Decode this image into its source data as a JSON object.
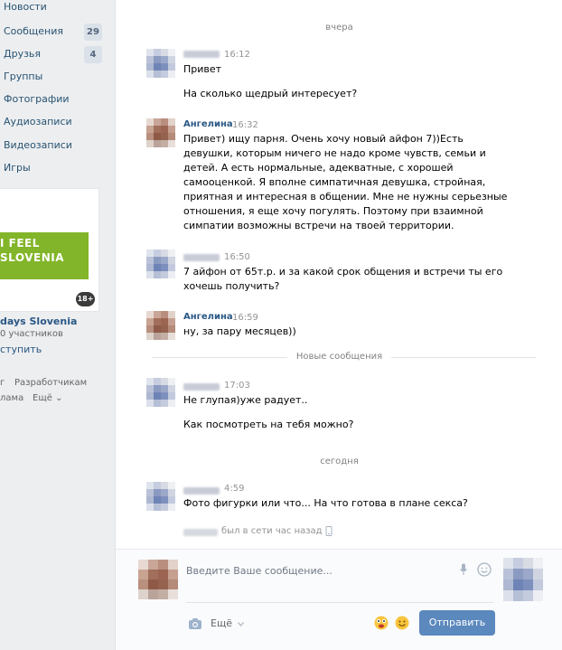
{
  "sidebar": {
    "items": [
      {
        "label": "Новости",
        "badge": ""
      },
      {
        "label": "Сообщения",
        "badge": "29"
      },
      {
        "label": "Друзья",
        "badge": "4"
      },
      {
        "label": "Группы",
        "badge": ""
      },
      {
        "label": "Фотографии",
        "badge": ""
      },
      {
        "label": "Аудиозаписи",
        "badge": ""
      },
      {
        "label": "Видеозаписи",
        "badge": ""
      },
      {
        "label": "Игры",
        "badge": ""
      }
    ],
    "ad": {
      "banner_line1": "I FEEL",
      "banner_line2": "SLOVENIA",
      "age_badge": "18+",
      "title": "days Slovenia",
      "members": "0 участников",
      "join": "ступить"
    },
    "footer": {
      "link1": "г",
      "link2": "Разработчикам",
      "link3": "лама",
      "more": "Ещё ⌄"
    }
  },
  "chat": {
    "separators": {
      "yesterday": "вчера",
      "new_messages": "Новые сообщения",
      "today": "сегодня"
    },
    "messages": [
      {
        "author": "",
        "time": "16:12",
        "lines": [
          "Привет",
          "",
          "На сколько щедрый интересует?"
        ]
      },
      {
        "author": "Ангелина",
        "time": "16:32",
        "lines": [
          "Привет) ищу парня. Очень хочу новый айфон 7))Есть",
          "девушки, которым ничего не надо кроме чувств, семьи и",
          "детей. А есть нормальные, адекватные, с хорошей",
          "самооценкой. Я вполне симпатичная девушка, стройная,",
          "приятная и интересная в общении. Мне не нужны серьезные",
          "отношения, я еще хочу погулять. Поэтому при взаимной",
          "симпатии возможны встречи на твоей территории."
        ]
      },
      {
        "author": "",
        "time": "16:50",
        "lines": [
          "7 айфон от 65т.р. и за какой срок общения и встречи ты его",
          "хочешь получить?"
        ]
      },
      {
        "author": "Ангелина",
        "time": "16:59",
        "lines": [
          "ну, за пару месяцев))"
        ]
      },
      {
        "author": "",
        "time": "17:03",
        "lines": [
          "Не глупая)уже радует..",
          "",
          "Как посмотреть на тебя можно?"
        ]
      },
      {
        "author": "",
        "time": "4:59",
        "lines": [
          "Фото фигурки или что... На что готова в плане секса?"
        ]
      }
    ],
    "status": "был в сети час назад",
    "compose": {
      "placeholder": "Введите Ваше сообщение...",
      "more": "Ещё",
      "send": "Отправить"
    }
  }
}
